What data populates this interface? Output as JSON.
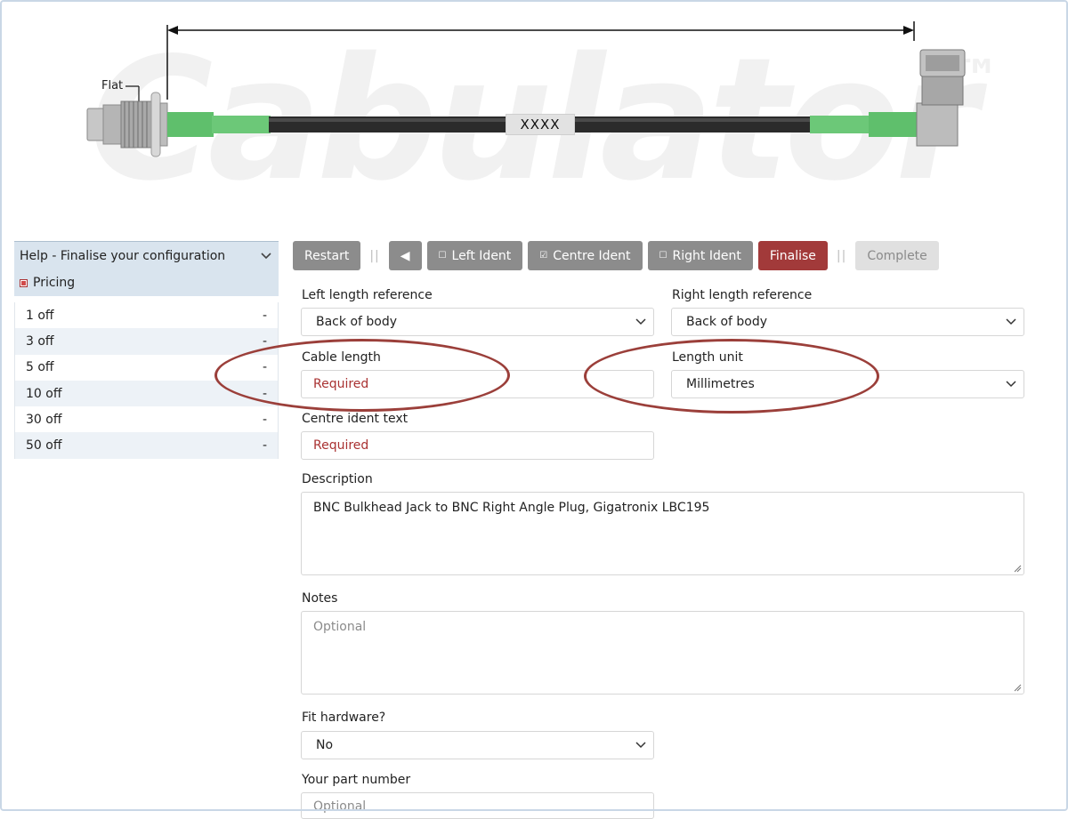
{
  "hero": {
    "watermark": "Cabulator",
    "watermark_tm": "™",
    "flat_label": "Flat",
    "centre_ident_text": "XXXX"
  },
  "help": {
    "title": "Help - Finalise your configuration",
    "chevron_icon": "chevron-down-icon",
    "pricing_label": "Pricing",
    "pricing_icon": "collapse-square-icon",
    "rows": [
      {
        "qty": "1 off",
        "price": "-"
      },
      {
        "qty": "3 off",
        "price": "-"
      },
      {
        "qty": "5 off",
        "price": "-"
      },
      {
        "qty": "10 off",
        "price": "-"
      },
      {
        "qty": "30 off",
        "price": "-"
      },
      {
        "qty": "50 off",
        "price": "-"
      }
    ]
  },
  "toolbar": {
    "restart": "Restart",
    "separator": "||",
    "back_icon": "◀",
    "left_ident": "Left Ident",
    "left_ident_check": "☐",
    "centre_ident": "Centre Ident",
    "centre_ident_check": "☑",
    "right_ident": "Right Ident",
    "right_ident_check": "☐",
    "finalise": "Finalise",
    "complete": "Complete"
  },
  "form": {
    "left_ref_label": "Left length reference",
    "left_ref_value": "Back of body",
    "right_ref_label": "Right length reference",
    "right_ref_value": "Back of body",
    "cable_length_label": "Cable length",
    "cable_length_placeholder": "Required",
    "length_unit_label": "Length unit",
    "length_unit_value": "Millimetres",
    "centre_ident_label": "Centre ident text",
    "centre_ident_placeholder": "Required",
    "description_label": "Description",
    "description_value": "BNC Bulkhead Jack to BNC Right Angle Plug, Gigatronix LBC195",
    "notes_label": "Notes",
    "notes_placeholder": "Optional",
    "fit_hardware_label": "Fit hardware?",
    "fit_hardware_value": "No",
    "part_number_label": "Your part number",
    "part_number_placeholder": "Optional"
  },
  "colors": {
    "accent_red": "#a23a3a",
    "button_grey": "#8c8c8c",
    "panel_blue": "#d9e4ee",
    "cable_green": "#5fbf6c"
  }
}
